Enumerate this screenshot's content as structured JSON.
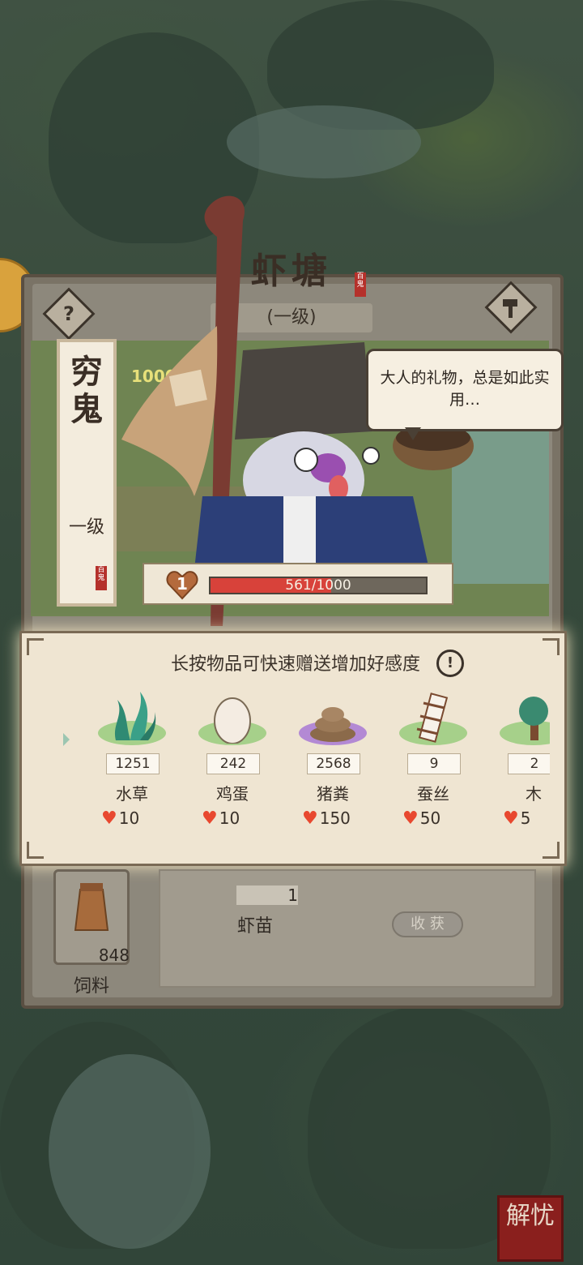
{
  "header": {
    "title": "虾塘",
    "level_badge": "(一级)",
    "help_icon": "?",
    "build_icon": "hammer-icon"
  },
  "farm": {
    "progress_text": "1000"
  },
  "character": {
    "name": "穷鬼",
    "level": "一级",
    "speech": "大人的礼物，总是如此实用…",
    "affection_level": "1",
    "affection_text": "561/1000",
    "affection_fraction": 0.561
  },
  "gift_panel": {
    "hint": "长按物品可快速赠送增加好感度",
    "info_icon": "!",
    "items": [
      {
        "name": "水草",
        "count": "1251",
        "affection": "10",
        "icon": "seaweed-icon"
      },
      {
        "name": "鸡蛋",
        "count": "242",
        "affection": "10",
        "icon": "egg-icon"
      },
      {
        "name": "猪粪",
        "count": "2568",
        "affection": "150",
        "icon": "dung-icon"
      },
      {
        "name": "蚕丝",
        "count": "9",
        "affection": "50",
        "icon": "silk-icon"
      },
      {
        "name": "木",
        "count": "2",
        "affection": "5",
        "icon": "tree-icon"
      }
    ]
  },
  "bottom": {
    "feed_count": "848",
    "feed_label": "饲料",
    "shrimp_count": "1",
    "shrimp_label": "虾苗",
    "harvest_label": "收 获"
  },
  "corner_stamp": "解忧",
  "colors": {
    "heart": "#e8482f",
    "affection_bar": "#d8423a",
    "panel_bg": "#efe5d2"
  }
}
